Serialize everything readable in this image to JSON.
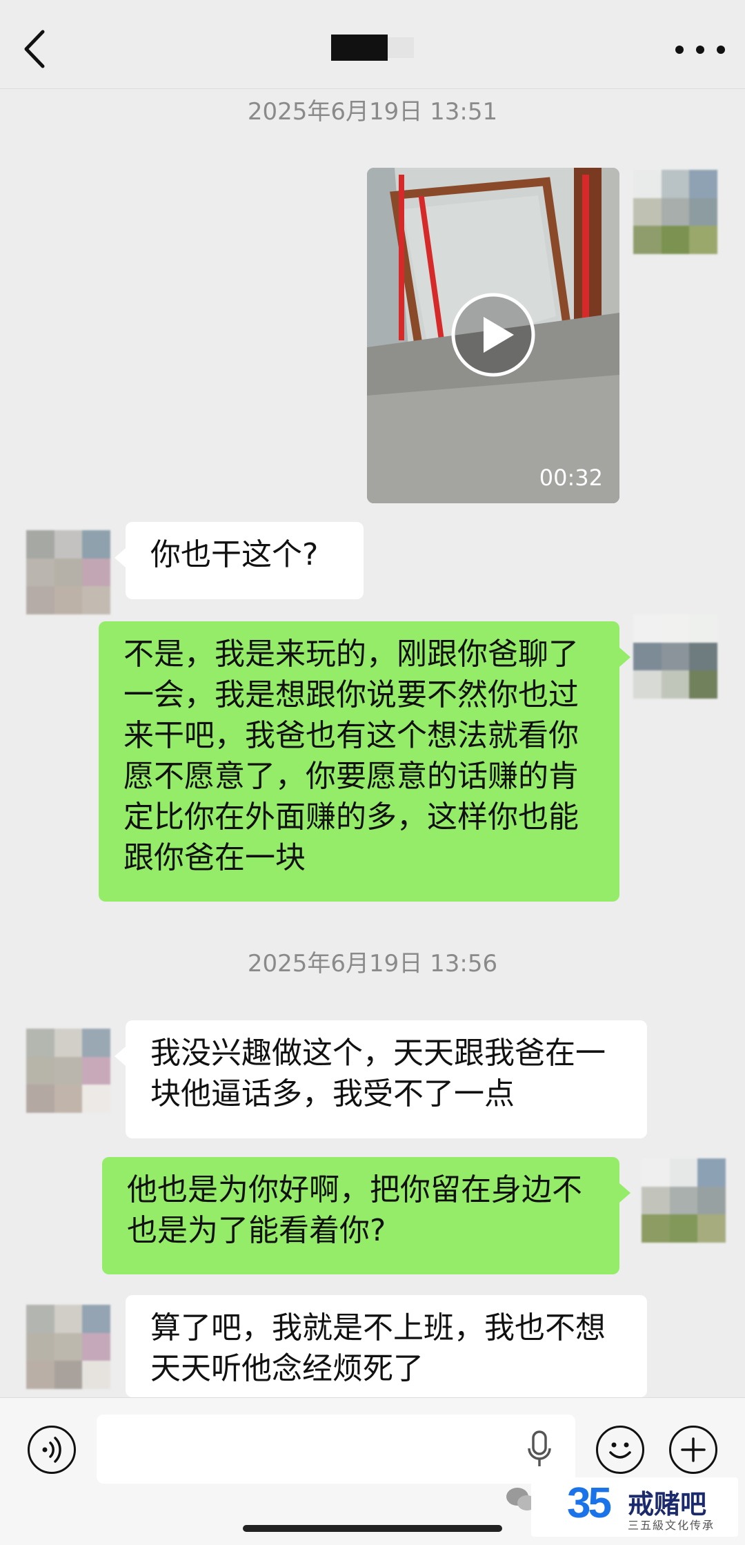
{
  "header": {
    "back_icon": "chevron-left-icon",
    "more_icon": "ellipsis-icon"
  },
  "messages": {
    "timestamp_1": "2025年6月19日 13:51",
    "video_duration": "00:32",
    "msg_1": "你也干这个?",
    "msg_2_lines": [
      "不是，我是来玩的，刚跟你爸聊了",
      "一会，我是想跟你说要不然你也过",
      "来干吧，我爸也有这个想法就看你",
      "愿不愿意了，你要愿意的话赚的肯",
      "定比你在外面赚的多，这样你也能",
      "跟你爸在一块"
    ],
    "timestamp_2": "2025年6月19日 13:56",
    "msg_3_lines": [
      "我没兴趣做这个，天天跟我爸在一",
      "块他逼话多，我受不了一点"
    ],
    "msg_4_lines": [
      "他也是为你好啊，把你留在身边不",
      "也是为了能看着你?"
    ],
    "msg_5_lines": [
      "算了吧，我就是不上班，我也不想",
      "天天听他念经烦死了"
    ]
  },
  "watermark": {
    "number": "35",
    "brand": "戒赌吧",
    "slogan": "三五級文化传承"
  },
  "colors": {
    "background": "#ededed",
    "green_bubble": "#95ec69",
    "white_bubble": "#ffffff"
  }
}
